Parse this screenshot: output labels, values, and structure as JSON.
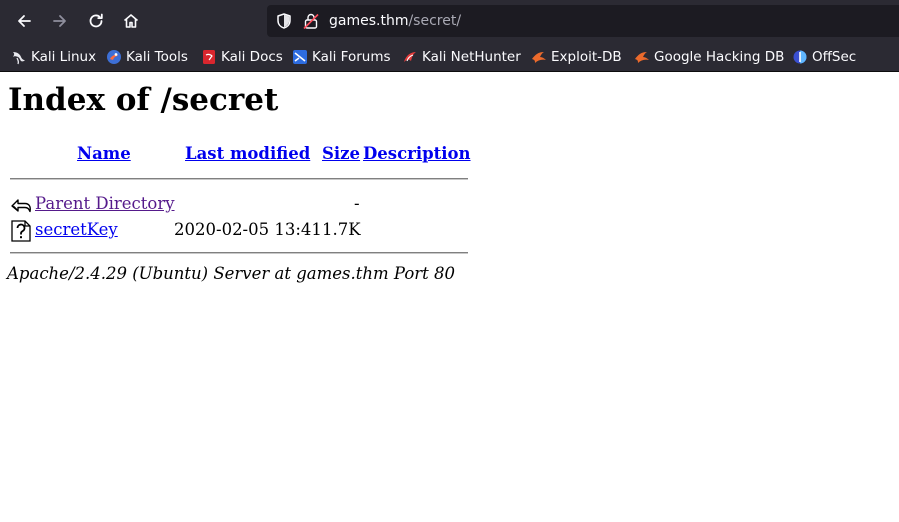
{
  "browser": {
    "url_host": "games.thm",
    "url_path": "/secret/",
    "bookmarks": [
      {
        "label": "Kali Linux",
        "icon": "kali-dragon-icon"
      },
      {
        "label": "Kali Tools",
        "icon": "kali-tools-icon"
      },
      {
        "label": "Kali Docs",
        "icon": "kali-docs-icon"
      },
      {
        "label": "Kali Forums",
        "icon": "kali-forums-icon"
      },
      {
        "label": "Kali NetHunter",
        "icon": "nethunter-icon"
      },
      {
        "label": "Exploit-DB",
        "icon": "exploit-db-icon"
      },
      {
        "label": "Google Hacking DB",
        "icon": "ghdb-icon"
      },
      {
        "label": "OffSec",
        "icon": "offsec-icon"
      }
    ]
  },
  "page": {
    "title": "Index of /secret",
    "columns": {
      "name": "Name",
      "last_modified": "Last modified",
      "size": "Size",
      "description": "Description"
    },
    "rows": [
      {
        "icon": "back-arrow-icon",
        "name": "Parent Directory",
        "last_modified": "",
        "size": "-",
        "description": ""
      },
      {
        "icon": "unknown-file-icon",
        "name": "secretKey",
        "last_modified": "2020-02-05 13:41",
        "size": "1.7K",
        "description": ""
      }
    ],
    "footer": "Apache/2.4.29 (Ubuntu) Server at games.thm Port 80"
  },
  "colors": {
    "chrome_bg": "#2b2a33",
    "urlbar_bg": "#1c1b22",
    "link": "#0000ee",
    "visited_link": "#551a8b"
  }
}
